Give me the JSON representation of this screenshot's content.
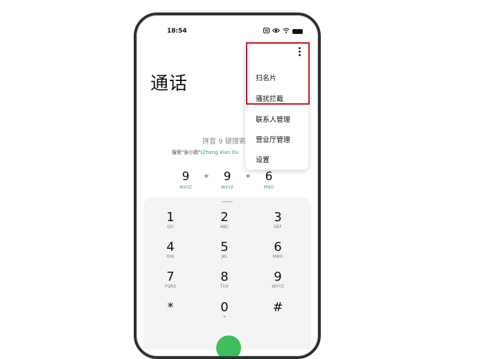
{
  "status_bar": {
    "time": "18:54",
    "icons": [
      "nfc-icon",
      "eye-comfort-icon",
      "wifi-icon",
      "battery-icon"
    ]
  },
  "dialer": {
    "title": "通话",
    "hint": "拼音 9 键搜索",
    "search_hint_prefix": "搜索\"张小欧\"(",
    "search_hint_pinyin": "Zhang Xiao Ou",
    "input_digits": [
      {
        "digit": "9",
        "letters": "WXYZ"
      },
      {
        "digit": "9",
        "letters": "WXYZ"
      },
      {
        "digit": "6",
        "letters": "MNO"
      }
    ],
    "plus": "+"
  },
  "keypad": [
    {
      "n": "1",
      "l": "QO"
    },
    {
      "n": "2",
      "l": "ABC"
    },
    {
      "n": "3",
      "l": "DEF"
    },
    {
      "n": "4",
      "l": "GHI"
    },
    {
      "n": "5",
      "l": "JKL"
    },
    {
      "n": "6",
      "l": "MNO"
    },
    {
      "n": "7",
      "l": "PQRS"
    },
    {
      "n": "8",
      "l": "TUV"
    },
    {
      "n": "9",
      "l": "WXYZ"
    },
    {
      "n": "*",
      "l": ""
    },
    {
      "n": "0",
      "l": "+"
    },
    {
      "n": "#",
      "l": ""
    }
  ],
  "menu": {
    "items": [
      "扫名片",
      "骚扰拦截",
      "联系人管理",
      "营业厅管理",
      "设置"
    ]
  },
  "colors": {
    "highlight": "#c8141e",
    "accent_green": "#2fa84f",
    "call_button": "#3cbf5c"
  }
}
